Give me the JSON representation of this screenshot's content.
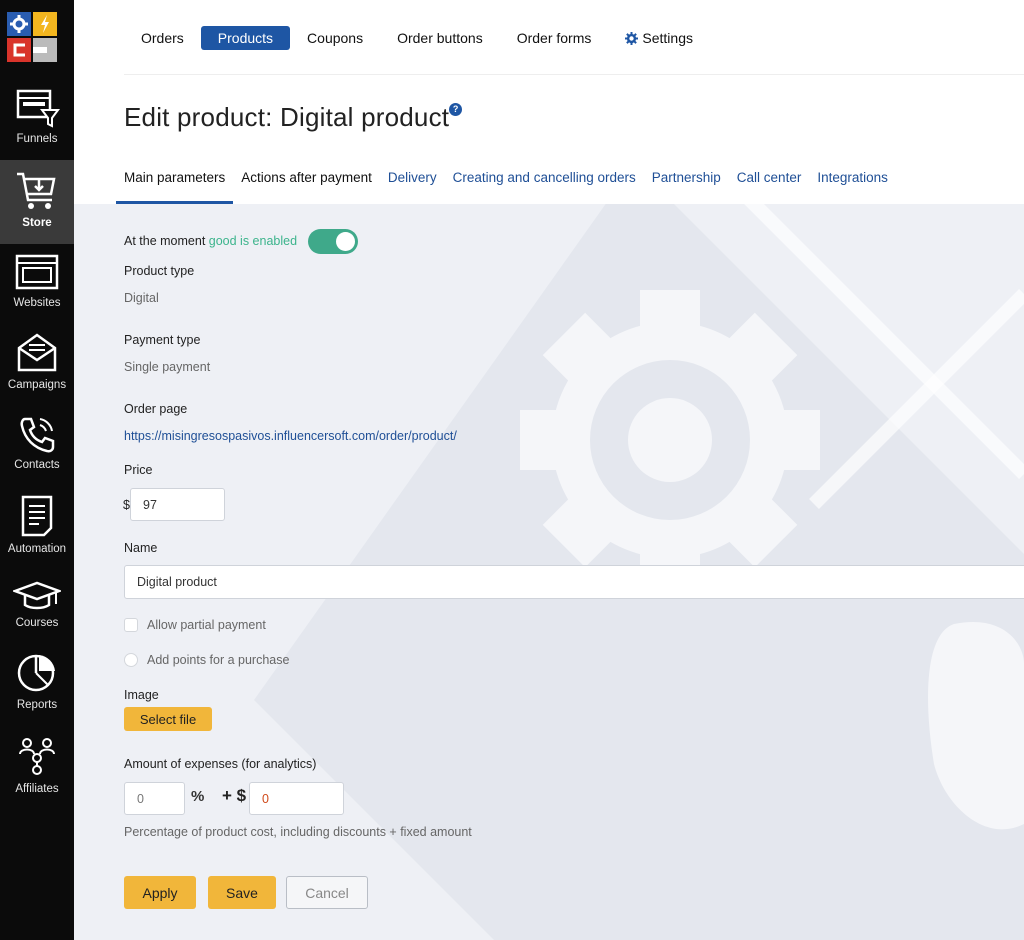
{
  "sidebar": {
    "items": [
      {
        "label": "Funnels",
        "icon": "funnel-icon"
      },
      {
        "label": "Store",
        "icon": "cart-icon"
      },
      {
        "label": "Websites",
        "icon": "browser-window-icon"
      },
      {
        "label": "Campaigns",
        "icon": "envelope-icon"
      },
      {
        "label": "Contacts",
        "icon": "phone-icon"
      },
      {
        "label": "Automation",
        "icon": "document-icon"
      },
      {
        "label": "Courses",
        "icon": "graduation-cap-icon"
      },
      {
        "label": "Reports",
        "icon": "pie-chart-icon"
      },
      {
        "label": "Affiliates",
        "icon": "network-icon"
      }
    ],
    "active": "Store"
  },
  "topmenu": {
    "items": [
      "Orders",
      "Products",
      "Coupons",
      "Order buttons",
      "Order forms",
      "Settings"
    ],
    "active": "Products"
  },
  "page": {
    "title": "Edit product: Digital product",
    "help": "?"
  },
  "tabs": {
    "items": [
      "Main parameters",
      "Actions after payment",
      "Delivery",
      "Creating and cancelling orders",
      "Partnership",
      "Call center",
      "Integrations"
    ],
    "active": "Main parameters"
  },
  "form": {
    "status_prefix": "At the moment",
    "status_value": "good is enabled",
    "enabled": true,
    "product_type_label": "Product type",
    "product_type_value": "Digital",
    "payment_type_label": "Payment type",
    "payment_type_value": "Single payment",
    "order_page_label": "Order page",
    "order_page_url": "https://misingresospasivos.influencersoft.com/order/product/",
    "price_label": "Price",
    "currency": "$",
    "price_value": "97",
    "name_label": "Name",
    "name_value": "Digital product",
    "partial_payment_label": "Allow partial payment",
    "points_label": "Add points for a purchase",
    "image_label": "Image",
    "select_file": "Select file",
    "expenses_label": "Amount of expenses (for analytics)",
    "expenses_percent": "0",
    "percent_sign": "%",
    "plus_dollar": "+ $",
    "expenses_fixed": "0",
    "expenses_hint": "Percentage of product cost, including discounts + fixed amount"
  },
  "actions": {
    "apply": "Apply",
    "save": "Save",
    "cancel": "Cancel"
  },
  "colors": {
    "accent": "#1e56a4",
    "toggle_on": "#3fa98a",
    "button": "#f1b63a"
  }
}
